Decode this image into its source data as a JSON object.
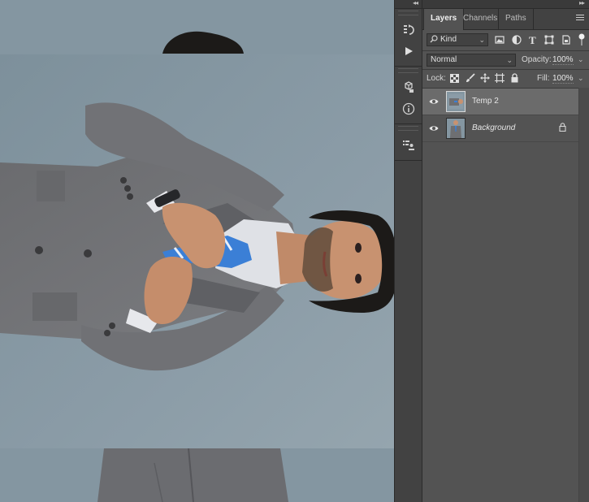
{
  "canvas": {
    "colors": {
      "backdrop": "#8a9ba6",
      "suit": "#6e6f72",
      "shirt": "#dfe1e6",
      "tie": "#3b7fd6",
      "skin": "#c89270",
      "hair": "#1c1a18"
    }
  },
  "toolstrip": {
    "collapse_glyph": "◂◂",
    "tools": [
      "history-icon",
      "play-icon",
      "3d-icon",
      "info-icon",
      "layer-comps-icon"
    ]
  },
  "panel": {
    "collapse_glyph": "▸▸",
    "tabs": [
      {
        "label": "Layers",
        "active": true
      },
      {
        "label": "Channels",
        "active": false
      },
      {
        "label": "Paths",
        "active": false
      }
    ],
    "filter": {
      "kind_label": "Kind",
      "filter_icons": [
        "image-filter-icon",
        "adjustment-filter-icon",
        "type-filter-icon",
        "shape-filter-icon",
        "smart-object-filter-icon"
      ]
    },
    "blend": {
      "mode": "Normal",
      "opacity_label": "Opacity:",
      "opacity_value": "100%"
    },
    "lock": {
      "lock_label": "Lock:",
      "fill_label": "Fill:",
      "fill_value": "100%",
      "lock_icons": [
        "lock-transparent-icon",
        "lock-image-icon",
        "lock-position-icon",
        "lock-artboard-icon",
        "lock-all-icon"
      ]
    },
    "layers": [
      {
        "name": "Temp 2",
        "selected": true,
        "visible": true,
        "locked": false
      },
      {
        "name": "Background",
        "selected": false,
        "visible": true,
        "locked": true
      }
    ]
  }
}
